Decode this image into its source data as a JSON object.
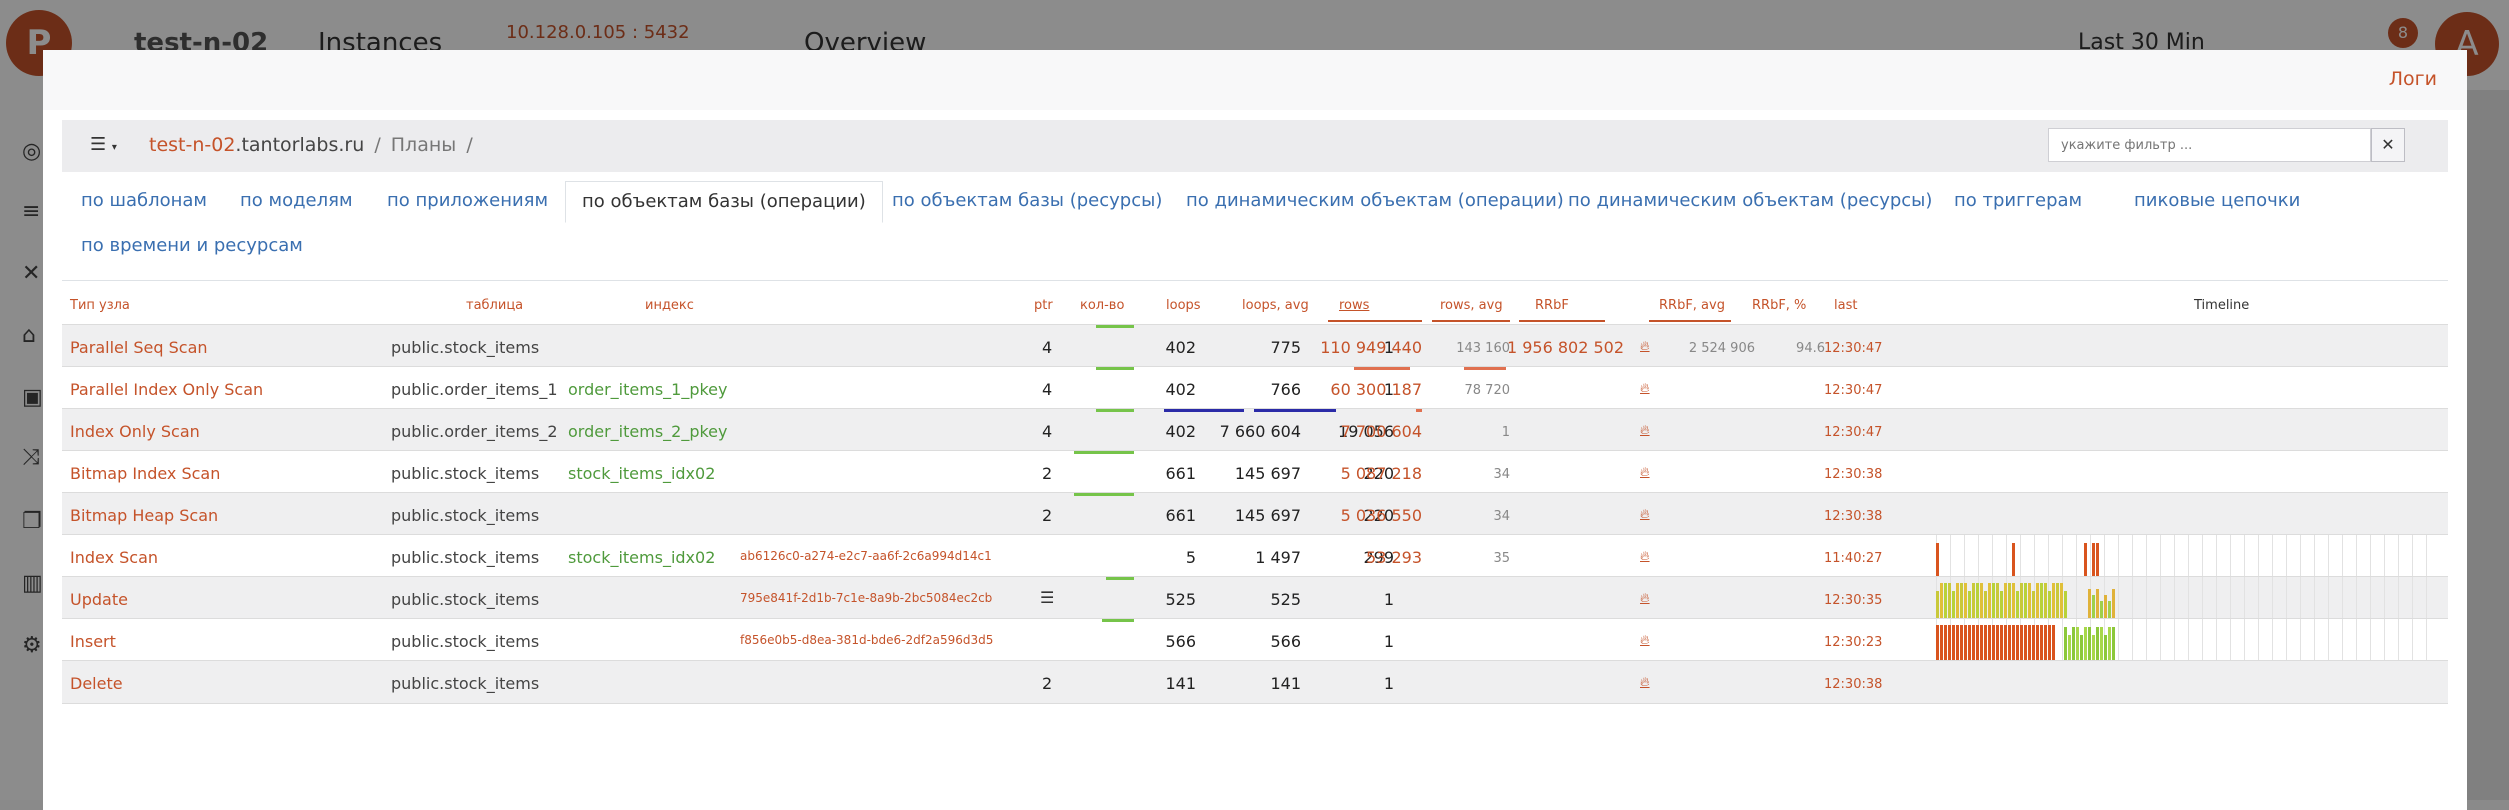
{
  "background": {
    "title": "test-n-02",
    "section": "Instances",
    "address": "10.128.0.105 : 5432",
    "page": "Overview",
    "period": "Last 30 Min",
    "notifications": "8",
    "avatar": "A"
  },
  "modal": {
    "logs_link": "Логи",
    "breadcrumb": {
      "host_prefix": "test-n-02",
      "host_suffix": ".tantorlabs.ru",
      "sep1": "/",
      "section": "Планы",
      "sep2": "/"
    },
    "filter_placeholder": "укажите фильтр ...",
    "tabs": [
      {
        "label": "по шаблонам"
      },
      {
        "label": "по моделям"
      },
      {
        "label": "по приложениям"
      },
      {
        "label": "по объектам базы (операции)",
        "active": true
      },
      {
        "label": "по объектам базы (ресурсы)"
      },
      {
        "label": "по динамическим объектам (операции)"
      },
      {
        "label": "по динамическим объектам (ресурсы)"
      },
      {
        "label": "по триггерам"
      },
      {
        "label": "пиковые цепочки"
      },
      {
        "label": "по времени и ресурсам"
      }
    ],
    "columns": {
      "node_type": "Тип узла",
      "table": "таблица",
      "index": "индекс",
      "ptr": "ptr",
      "count": "кол-во",
      "loops": "loops",
      "loops_avg": "loops, avg",
      "rows": "rows",
      "rows_avg": "rows, avg",
      "rrbf": "RRbF",
      "rrbf_avg": "RRbF, avg",
      "rrbf_pct": "RRbF, %",
      "last": "last",
      "timeline": "Timeline"
    },
    "rows": [
      {
        "node": "Parallel Seq Scan",
        "table": "public.stock_items",
        "index": "",
        "hash": "",
        "ptr": "4",
        "count": "402",
        "loops": "775",
        "loops_avg": "1",
        "rows": "110 949 440",
        "rows_avg": "143 160",
        "rrbf": "1 956 802 502",
        "rrbf_avg": "2 524 906",
        "rrbf_pct": "94.6",
        "last": "12:30:47"
      },
      {
        "node": "Parallel Index Only Scan",
        "table": "public.order_items_1",
        "index": "order_items_1_pkey",
        "hash": "",
        "ptr": "4",
        "count": "402",
        "loops": "766",
        "loops_avg": "1",
        "rows": "60 300 187",
        "rows_avg": "78 720",
        "rrbf": "",
        "rrbf_avg": "",
        "rrbf_pct": "",
        "last": "12:30:47"
      },
      {
        "node": "Index Only Scan",
        "table": "public.order_items_2",
        "index": "order_items_2_pkey",
        "hash": "",
        "ptr": "4",
        "count": "402",
        "loops": "7 660 604",
        "loops_avg": "19 056",
        "rows": "7 700 604",
        "rows_avg": "1",
        "rrbf": "",
        "rrbf_avg": "",
        "rrbf_pct": "",
        "last": "12:30:47"
      },
      {
        "node": "Bitmap Index Scan",
        "table": "public.stock_items",
        "index": "stock_items_idx02",
        "hash": "",
        "ptr": "2",
        "count": "661",
        "loops": "145 697",
        "loops_avg": "220",
        "rows": "5 087 218",
        "rows_avg": "34",
        "rrbf": "",
        "rrbf_avg": "",
        "rrbf_pct": "",
        "last": "12:30:38"
      },
      {
        "node": "Bitmap Heap Scan",
        "table": "public.stock_items",
        "index": "",
        "hash": "",
        "ptr": "2",
        "count": "661",
        "loops": "145 697",
        "loops_avg": "220",
        "rows": "5 036 550",
        "rows_avg": "34",
        "rrbf": "",
        "rrbf_avg": "",
        "rrbf_pct": "",
        "last": "12:30:38"
      },
      {
        "node": "Index Scan",
        "table": "public.stock_items",
        "index": "stock_items_idx02",
        "hash": "ab6126c0-a274-e2c7-aa6f-2c6a994d14c1",
        "ptr": "",
        "count": "5",
        "loops": "1 497",
        "loops_avg": "299",
        "rows": "53 293",
        "rows_avg": "35",
        "rrbf": "",
        "rrbf_avg": "",
        "rrbf_pct": "",
        "last": "11:40:27"
      },
      {
        "node": "Update",
        "table": "public.stock_items",
        "index": "",
        "hash": "795e841f-2d1b-7c1e-8a9b-2bc5084ec2cb",
        "ptr": "",
        "count": "525",
        "loops": "525",
        "loops_avg": "1",
        "rows": "",
        "rows_avg": "",
        "rrbf": "",
        "rrbf_avg": "",
        "rrbf_pct": "",
        "last": "12:30:35"
      },
      {
        "node": "Insert",
        "table": "public.stock_items",
        "index": "",
        "hash": "f856e0b5-d8ea-381d-bde6-2df2a596d3d5",
        "ptr": "",
        "count": "566",
        "loops": "566",
        "loops_avg": "1",
        "rows": "",
        "rows_avg": "",
        "rrbf": "",
        "rrbf_avg": "",
        "rrbf_pct": "",
        "last": "12:30:23"
      },
      {
        "node": "Delete",
        "table": "public.stock_items",
        "index": "",
        "hash": "",
        "ptr": "2",
        "count": "141",
        "loops": "141",
        "loops_avg": "1",
        "rows": "",
        "rows_avg": "",
        "rrbf": "",
        "rrbf_avg": "",
        "rrbf_pct": "",
        "last": "12:30:38"
      }
    ],
    "icons": {
      "list": "list-menu-icon",
      "clear": "close-icon",
      "fire": "fire-icon",
      "plan": "plan-list-icon"
    },
    "colors": {
      "accent": "#c5532a",
      "link": "#3a6fb0",
      "index_green": "#4f9a3c"
    }
  }
}
